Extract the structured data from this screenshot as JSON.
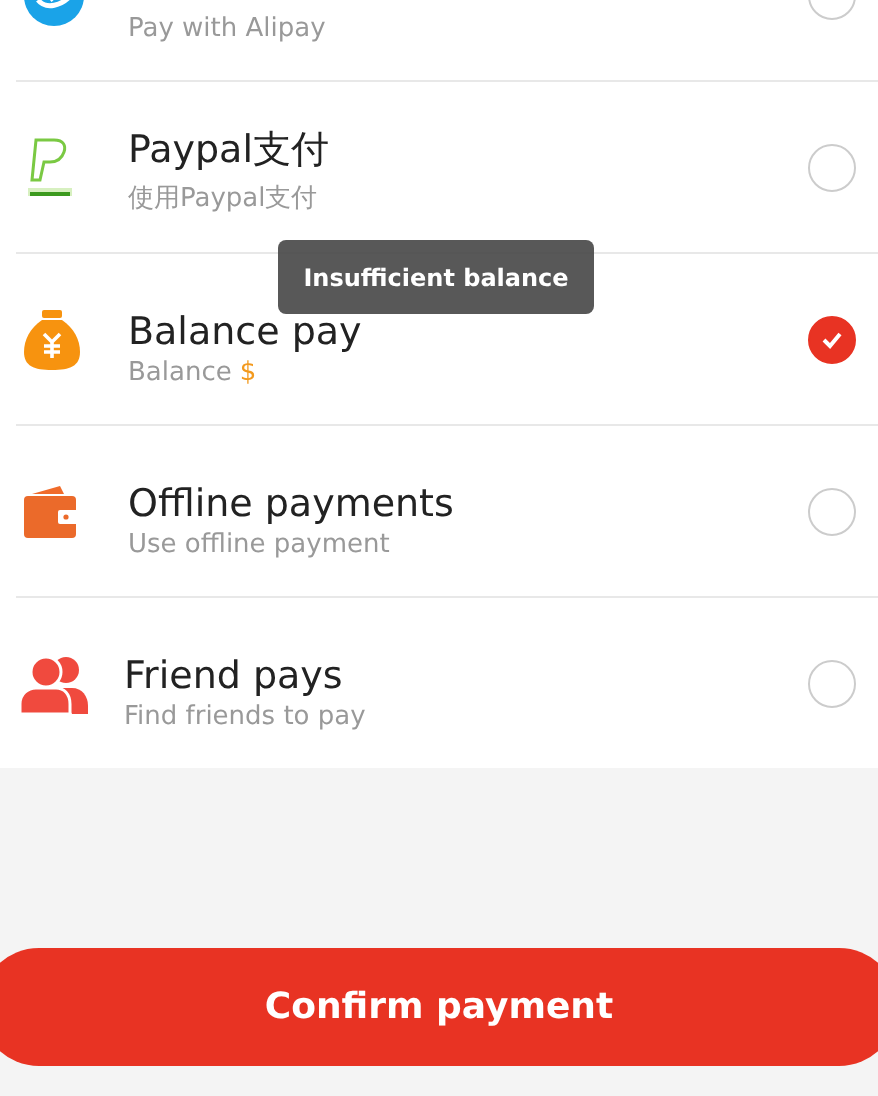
{
  "methods": [
    {
      "kind": "alipay",
      "subtitle": "Pay with Alipay",
      "selected": false
    },
    {
      "kind": "paypal",
      "title": "Paypal支付",
      "subtitle": "使用Paypal支付",
      "selected": false
    },
    {
      "kind": "balance",
      "title": "Balance pay",
      "subtitle": "Balance",
      "amount": "$",
      "selected": true
    },
    {
      "kind": "offline",
      "title": "Offline payments",
      "subtitle": "Use offline payment",
      "selected": false
    },
    {
      "kind": "friend",
      "title": "Friend pays",
      "subtitle": "Find friends to pay",
      "selected": false
    }
  ],
  "toast": "Insufficient balance",
  "confirm_button": "Confirm payment"
}
